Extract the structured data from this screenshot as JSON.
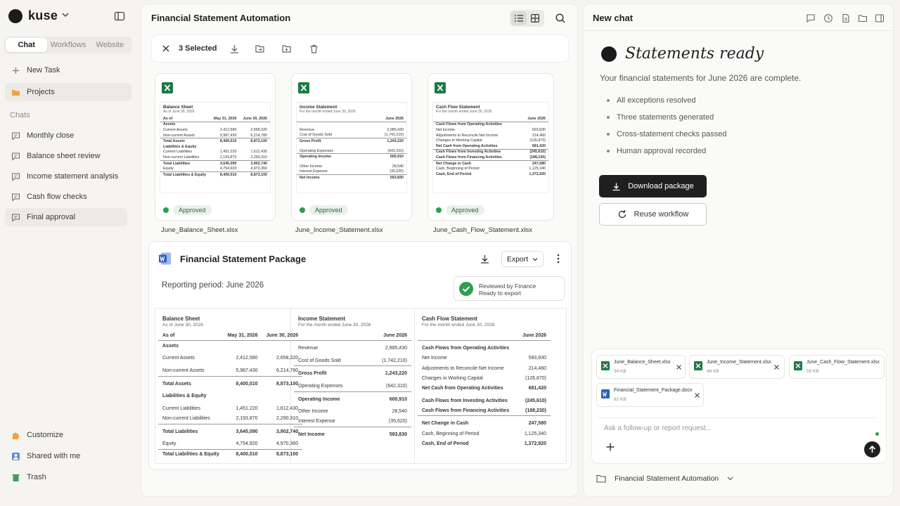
{
  "sidebar": {
    "brand": "kuse",
    "tabs": [
      "Chat",
      "Workflows",
      "Website"
    ],
    "active_tab": "Chat",
    "new_task": "New Task",
    "projects": "Projects",
    "chats_heading": "Chats",
    "chats": [
      "Monthly close",
      "Balance sheet review",
      "Income statement analysis",
      "Cash flow checks",
      "Final approval"
    ],
    "selected_chat": "Final approval",
    "bottom": [
      "Customize",
      "Shared with me",
      "Trash"
    ]
  },
  "main": {
    "title": "Financial Statement Automation",
    "selected_count": "3 Selected",
    "files": [
      {
        "name": "June_Balance_Sheet.xlsx",
        "status": "Approved",
        "doc_title": "Balance Sheet",
        "doc_sub": "As of June 30, 2026",
        "columns": [
          "As of",
          "May 31, 2026",
          "June 30, 2026"
        ],
        "rows": [
          [
            "Assets",
            "",
            ""
          ],
          [
            "Current Assets",
            "2,412,580",
            "2,658,320"
          ],
          [
            "Non-current Assets",
            "5,987,430",
            "6,214,780"
          ],
          [
            "Total Assets",
            "8,400,010",
            "8,873,100"
          ],
          [
            "Liabilities & Equity",
            "",
            ""
          ],
          [
            "Current Liabilities",
            "1,451,220",
            "1,612,430"
          ],
          [
            "Non-current Liabilities",
            "2,193,870",
            "2,290,310"
          ],
          [
            "Total Liabilities",
            "3,645,090",
            "3,902,740"
          ],
          [
            "Equity",
            "4,754,920",
            "4,970,360"
          ],
          [
            "Total Liabilities & Equity",
            "8,400,010",
            "8,873,100"
          ]
        ]
      },
      {
        "name": "June_Income_Statement.xlsx",
        "status": "Approved",
        "doc_title": "Income Statement",
        "doc_sub": "For the month ended June 30, 2026",
        "columns": [
          "",
          "June 2026"
        ],
        "rows": [
          [
            "Revenue",
            "2,985,430"
          ],
          [
            "Cost of Goods Sold",
            "(1,742,210)"
          ],
          [
            "Gross Profit",
            "1,243,220"
          ],
          [
            "Operating Expenses",
            "(642,310)"
          ],
          [
            "Operating Income",
            "600,910"
          ],
          [
            "Other Income",
            "28,540"
          ],
          [
            "Interest Expense",
            "(35,620)"
          ],
          [
            "Net Income",
            "593,830"
          ]
        ]
      },
      {
        "name": "June_Cash_Flow_Statement.xlsx",
        "status": "Approved",
        "doc_title": "Cash Flow Statement",
        "doc_sub": "For the month ended June 30, 2026",
        "columns": [
          "",
          "June 2026"
        ],
        "rows": [
          [
            "Cash Flows from Operating Activities",
            ""
          ],
          [
            "Net Income",
            "593,830"
          ],
          [
            "Adjustments to Reconcile Net Income",
            "214,460"
          ],
          [
            "Changes in Working Capital",
            "(126,870)"
          ],
          [
            "Net Cash from Operating Activities",
            "681,420"
          ],
          [
            "Cash Flows from Investing Activities",
            "(245,610)"
          ],
          [
            "Cash Flows from Financing Activities",
            "(188,230)"
          ],
          [
            "Net Change in Cash",
            "247,580"
          ],
          [
            "Cash, Beginning of Period",
            "1,125,340"
          ],
          [
            "Cash, End of Period",
            "1,372,920"
          ]
        ]
      }
    ],
    "package": {
      "title": "Financial Statement Package",
      "export_label": "Export",
      "period": "Reporting period: June 2026",
      "review_line1": "Reviewed by Finance",
      "review_line2": "Ready to export"
    }
  },
  "right": {
    "title": "New chat",
    "heading": "Statements ready",
    "subtitle": "Your financial statements for June 2026 are complete.",
    "bullets": [
      "All exceptions resolved",
      "Three statements generated",
      "Cross-statement checks passed",
      "Human approval recorded"
    ],
    "download_label": "Download package",
    "reuse_label": "Reuse workflow",
    "attachments": [
      {
        "name": "June_Balance_Sheet.xlsx",
        "size": "54 KB",
        "type": "xlsx"
      },
      {
        "name": "June_Income_Statement.xlsx",
        "size": "48 KB",
        "type": "xlsx"
      },
      {
        "name": "June_Cash_Flow_Statement.xlsx",
        "size": "50 KB",
        "type": "xlsx"
      },
      {
        "name": "Financial_Statement_Package.docx",
        "size": "82 KB",
        "type": "docx"
      }
    ],
    "input_placeholder": "Ask a follow-up or report request...",
    "folder_label": "Financial Statement Automation"
  },
  "colors": {
    "accent_dark": "#1f1f1f",
    "approved_green": "#2e9e4f",
    "excel_green": "#1d7a45",
    "word_blue": "#2b5fb8",
    "folder_orange": "#f0a23b"
  }
}
